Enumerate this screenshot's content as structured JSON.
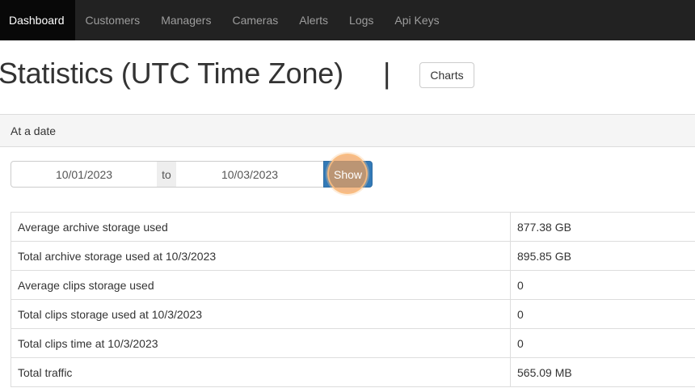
{
  "nav": {
    "items": [
      {
        "label": "Dashboard",
        "active": true
      },
      {
        "label": "Customers"
      },
      {
        "label": "Managers"
      },
      {
        "label": "Cameras"
      },
      {
        "label": "Alerts"
      },
      {
        "label": "Logs"
      },
      {
        "label": "Api Keys"
      }
    ]
  },
  "header": {
    "title": "Statistics (UTC Time Zone)",
    "separator": "|",
    "charts_button": "Charts"
  },
  "panel": {
    "heading": "At a date",
    "date_from": "10/01/2023",
    "range_separator": "to",
    "date_to": "10/03/2023",
    "show_button": "Show"
  },
  "stats": {
    "rows": [
      {
        "label": "Average archive storage used",
        "value": "877.38 GB"
      },
      {
        "label": "Total archive storage used at 10/3/2023",
        "value": "895.85 GB"
      },
      {
        "label": "Average clips storage used",
        "value": "0"
      },
      {
        "label": "Total clips storage used at 10/3/2023",
        "value": "0"
      },
      {
        "label": "Total clips time at 10/3/2023",
        "value": "0"
      },
      {
        "label": "Total traffic",
        "value": "565.09 MB"
      }
    ]
  },
  "colors": {
    "navbar_bg": "#222222",
    "nav_active_bg": "#080808",
    "primary_button": "#337ab7",
    "click_highlight": "#f0a05a"
  }
}
